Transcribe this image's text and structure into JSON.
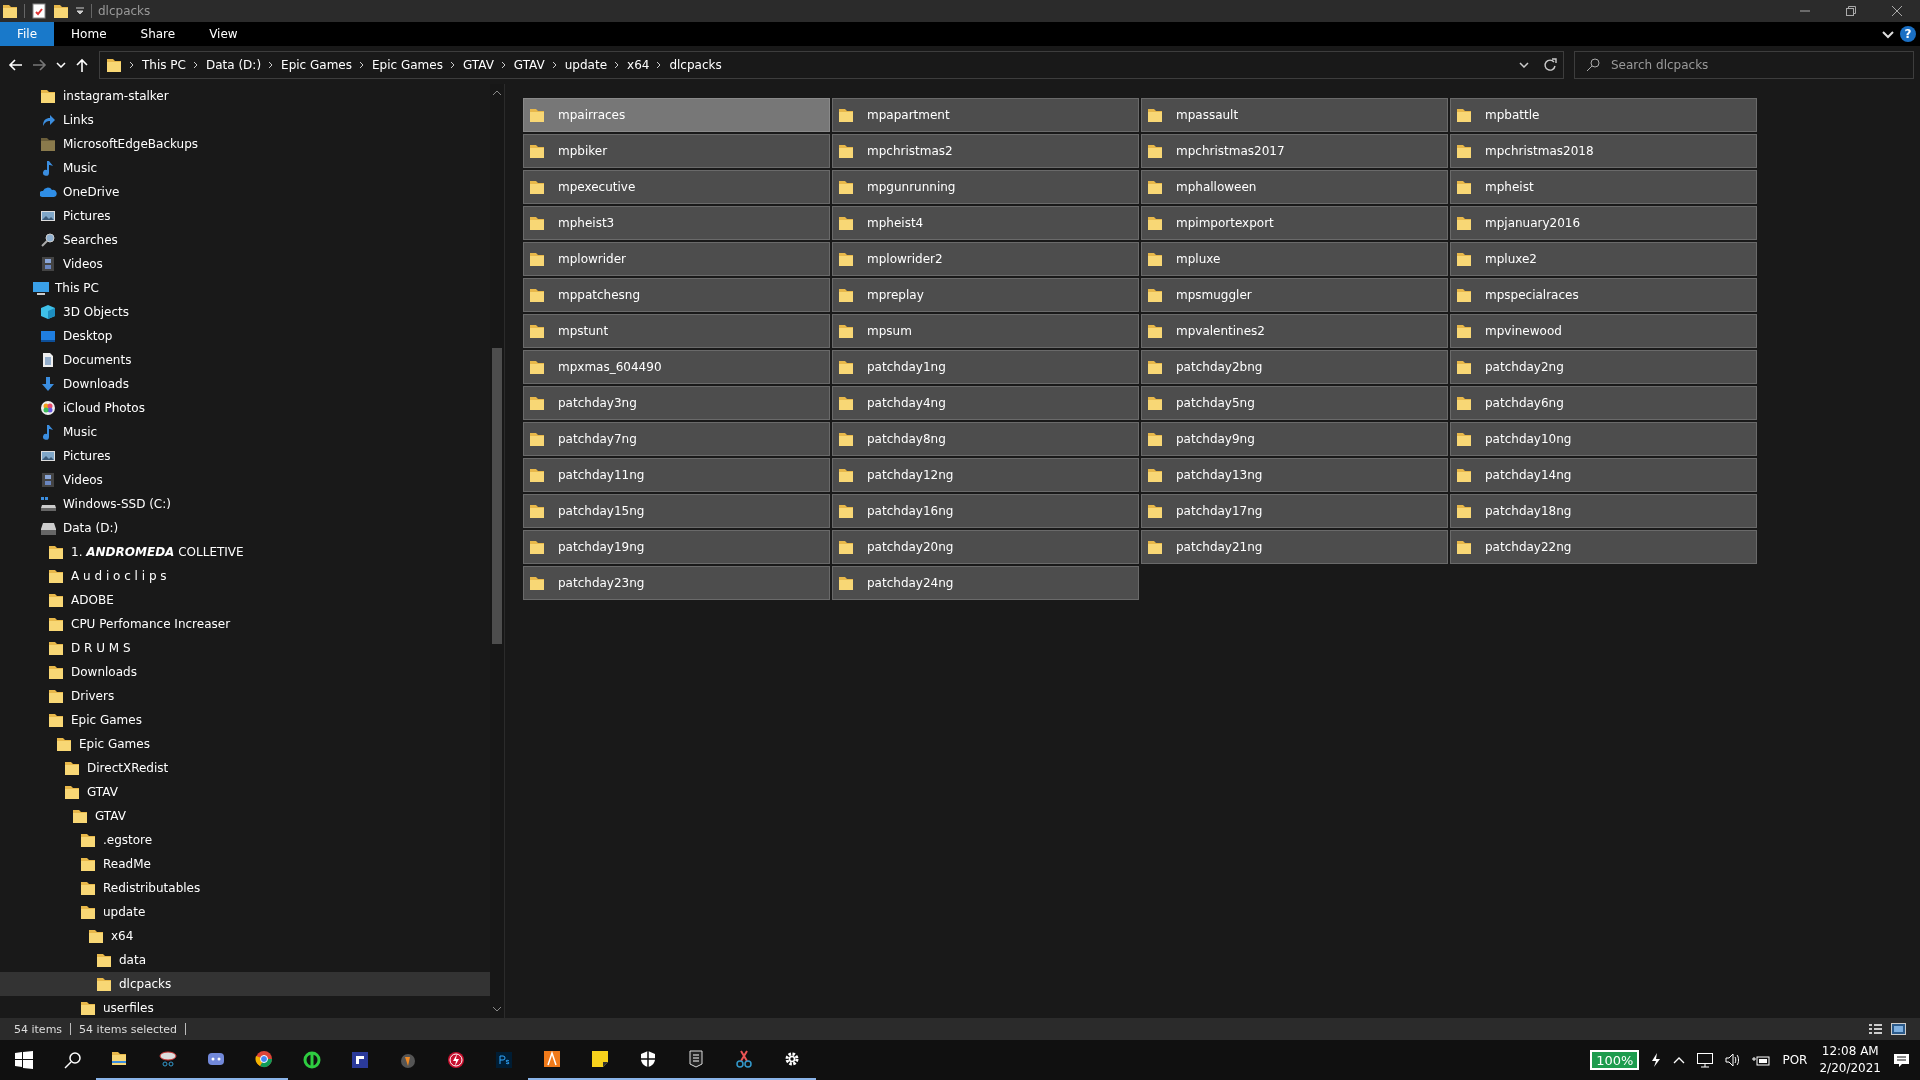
{
  "window": {
    "title": "dlcpacks"
  },
  "ribbon": {
    "tabs": [
      {
        "label": "File",
        "selected": true
      },
      {
        "label": "Home",
        "selected": false
      },
      {
        "label": "Share",
        "selected": false
      },
      {
        "label": "View",
        "selected": false
      }
    ],
    "help": "?"
  },
  "address_bar": {
    "path": [
      "This PC",
      "Data (D:)",
      "Epic Games",
      "Epic Games",
      "GTAV",
      "GTAV",
      "update",
      "x64",
      "dlcpacks"
    ]
  },
  "search": {
    "placeholder": "Search dlcpacks"
  },
  "navigation": [
    {
      "children": [
        {
          "label": "instagram-stalker",
          "kind": "folder",
          "selected": false
        },
        {
          "label": "Links",
          "kind": "link",
          "selected": false
        },
        {
          "label": "MicrosoftEdgeBackups",
          "kind": "darkfolder",
          "selected": false
        },
        {
          "label": "Music",
          "kind": "music",
          "selected": false
        },
        {
          "label": "OneDrive",
          "kind": "cloud",
          "selected": false
        },
        {
          "label": "Pictures",
          "kind": "pictures",
          "selected": false
        },
        {
          "label": "Searches",
          "kind": "search",
          "selected": false
        },
        {
          "label": "Videos",
          "kind": "videos",
          "selected": false
        }
      ]
    },
    {
      "label": "This PC",
      "kind": "pc",
      "selected": false,
      "children": [
        {
          "label": "3D Objects",
          "kind": "cube",
          "selected": false
        },
        {
          "label": "Desktop",
          "kind": "desktop",
          "selected": false
        },
        {
          "label": "Documents",
          "kind": "documents",
          "selected": false
        },
        {
          "label": "Downloads",
          "kind": "downloads",
          "selected": false
        },
        {
          "label": "iCloud Photos",
          "kind": "photos",
          "selected": false
        },
        {
          "label": "Music",
          "kind": "music",
          "selected": false
        },
        {
          "label": "Pictures",
          "kind": "pictures",
          "selected": false
        },
        {
          "label": "Videos",
          "kind": "videos",
          "selected": false
        },
        {
          "label": "Windows-SSD (C:)",
          "kind": "windrive",
          "selected": false
        },
        {
          "label": "Data (D:)",
          "kind": "drive",
          "selected": false,
          "children": [
            {
              "label": "1. **ANDROMEDA** COLLETIVE",
              "kind": "folder",
              "selected": false
            },
            {
              "label": "A u d i o c l i p s",
              "kind": "folder",
              "selected": false
            },
            {
              "label": "ADOBE",
              "kind": "folder",
              "selected": false
            },
            {
              "label": "CPU Perfomance Increaser",
              "kind": "folder",
              "selected": false
            },
            {
              "label": "D R U M S",
              "kind": "folder",
              "selected": false
            },
            {
              "label": "Downloads",
              "kind": "folder",
              "selected": false
            },
            {
              "label": "Drivers",
              "kind": "folder",
              "selected": false
            },
            {
              "label": "Epic Games",
              "kind": "folder",
              "selected": false,
              "children": [
                {
                  "label": "Epic Games",
                  "kind": "folder",
                  "selected": false,
                  "children": [
                    {
                      "label": "DirectXRedist",
                      "kind": "folder",
                      "selected": false
                    },
                    {
                      "label": "GTAV",
                      "kind": "folder",
                      "selected": false,
                      "children": [
                        {
                          "label": "GTAV",
                          "kind": "folder",
                          "selected": false,
                          "children": [
                            {
                              "label": ".egstore",
                              "kind": "folder",
                              "selected": false
                            },
                            {
                              "label": "ReadMe",
                              "kind": "folder",
                              "selected": false
                            },
                            {
                              "label": "Redistributables",
                              "kind": "folder",
                              "selected": false
                            },
                            {
                              "label": "update",
                              "kind": "folder",
                              "selected": false,
                              "children": [
                                {
                                  "label": "x64",
                                  "kind": "folder",
                                  "selected": false,
                                  "children": [
                                    {
                                      "label": "data",
                                      "kind": "folder",
                                      "selected": false
                                    },
                                    {
                                      "label": "dlcpacks",
                                      "kind": "folder",
                                      "selected": true
                                    }
                                  ]
                                }
                              ]
                            },
                            {
                              "label": "userfiles",
                              "kind": "folder",
                              "selected": false
                            }
                          ]
                        }
                      ]
                    }
                  ]
                }
              ]
            }
          ]
        }
      ]
    }
  ],
  "folders": [
    {
      "name": "mpairraces",
      "selected": true,
      "hovered": true
    },
    {
      "name": "mpapartment",
      "selected": true,
      "hovered": false
    },
    {
      "name": "mpassault",
      "selected": true,
      "hovered": false
    },
    {
      "name": "mpbattle",
      "selected": true,
      "hovered": false
    },
    {
      "name": "mpbiker",
      "selected": true,
      "hovered": false
    },
    {
      "name": "mpchristmas2",
      "selected": true,
      "hovered": false
    },
    {
      "name": "mpchristmas2017",
      "selected": true,
      "hovered": false
    },
    {
      "name": "mpchristmas2018",
      "selected": true,
      "hovered": false
    },
    {
      "name": "mpexecutive",
      "selected": true,
      "hovered": false
    },
    {
      "name": "mpgunrunning",
      "selected": true,
      "hovered": false
    },
    {
      "name": "mphalloween",
      "selected": true,
      "hovered": false
    },
    {
      "name": "mpheist",
      "selected": true,
      "hovered": false
    },
    {
      "name": "mpheist3",
      "selected": true,
      "hovered": false
    },
    {
      "name": "mpheist4",
      "selected": true,
      "hovered": false
    },
    {
      "name": "mpimportexport",
      "selected": true,
      "hovered": false
    },
    {
      "name": "mpjanuary2016",
      "selected": true,
      "hovered": false
    },
    {
      "name": "mplowrider",
      "selected": true,
      "hovered": false
    },
    {
      "name": "mplowrider2",
      "selected": true,
      "hovered": false
    },
    {
      "name": "mpluxe",
      "selected": true,
      "hovered": false
    },
    {
      "name": "mpluxe2",
      "selected": true,
      "hovered": false
    },
    {
      "name": "mppatchesng",
      "selected": true,
      "hovered": false
    },
    {
      "name": "mpreplay",
      "selected": true,
      "hovered": false
    },
    {
      "name": "mpsmuggler",
      "selected": true,
      "hovered": false
    },
    {
      "name": "mpspecialraces",
      "selected": true,
      "hovered": false
    },
    {
      "name": "mpstunt",
      "selected": true,
      "hovered": false
    },
    {
      "name": "mpsum",
      "selected": true,
      "hovered": false
    },
    {
      "name": "mpvalentines2",
      "selected": true,
      "hovered": false
    },
    {
      "name": "mpvinewood",
      "selected": true,
      "hovered": false
    },
    {
      "name": "mpxmas_604490",
      "selected": true,
      "hovered": false
    },
    {
      "name": "patchday1ng",
      "selected": true,
      "hovered": false
    },
    {
      "name": "patchday2bng",
      "selected": true,
      "hovered": false
    },
    {
      "name": "patchday2ng",
      "selected": true,
      "hovered": false
    },
    {
      "name": "patchday3ng",
      "selected": true,
      "hovered": false
    },
    {
      "name": "patchday4ng",
      "selected": true,
      "hovered": false
    },
    {
      "name": "patchday5ng",
      "selected": true,
      "hovered": false
    },
    {
      "name": "patchday6ng",
      "selected": true,
      "hovered": false
    },
    {
      "name": "patchday7ng",
      "selected": true,
      "hovered": false
    },
    {
      "name": "patchday8ng",
      "selected": true,
      "hovered": false
    },
    {
      "name": "patchday9ng",
      "selected": true,
      "hovered": false
    },
    {
      "name": "patchday10ng",
      "selected": true,
      "hovered": false
    },
    {
      "name": "patchday11ng",
      "selected": true,
      "hovered": false
    },
    {
      "name": "patchday12ng",
      "selected": true,
      "hovered": false
    },
    {
      "name": "patchday13ng",
      "selected": true,
      "hovered": false
    },
    {
      "name": "patchday14ng",
      "selected": true,
      "hovered": false
    },
    {
      "name": "patchday15ng",
      "selected": true,
      "hovered": false
    },
    {
      "name": "patchday16ng",
      "selected": true,
      "hovered": false
    },
    {
      "name": "patchday17ng",
      "selected": true,
      "hovered": false
    },
    {
      "name": "patchday18ng",
      "selected": true,
      "hovered": false
    },
    {
      "name": "patchday19ng",
      "selected": true,
      "hovered": false
    },
    {
      "name": "patchday20ng",
      "selected": true,
      "hovered": false
    },
    {
      "name": "patchday21ng",
      "selected": true,
      "hovered": false
    },
    {
      "name": "patchday22ng",
      "selected": true,
      "hovered": false
    },
    {
      "name": "patchday23ng",
      "selected": true,
      "hovered": false
    },
    {
      "name": "patchday24ng",
      "selected": true,
      "hovered": false
    }
  ],
  "status_bar": {
    "item_count": "54 items",
    "selection": "54 items selected"
  },
  "taskbar": {
    "apps": [
      {
        "running": true
      },
      {
        "running": true
      },
      {
        "running": true
      },
      {
        "running": true
      },
      {
        "running": false
      },
      {
        "running": false
      },
      {
        "running": false
      },
      {
        "running": false
      },
      {
        "running": false
      },
      {
        "running": true
      },
      {
        "running": true
      },
      {
        "running": true
      },
      {
        "running": true
      },
      {
        "running": true
      },
      {
        "running": true
      }
    ],
    "battery": "100%",
    "language": "POR",
    "time": "12:08 AM",
    "date": "2/20/2021"
  }
}
